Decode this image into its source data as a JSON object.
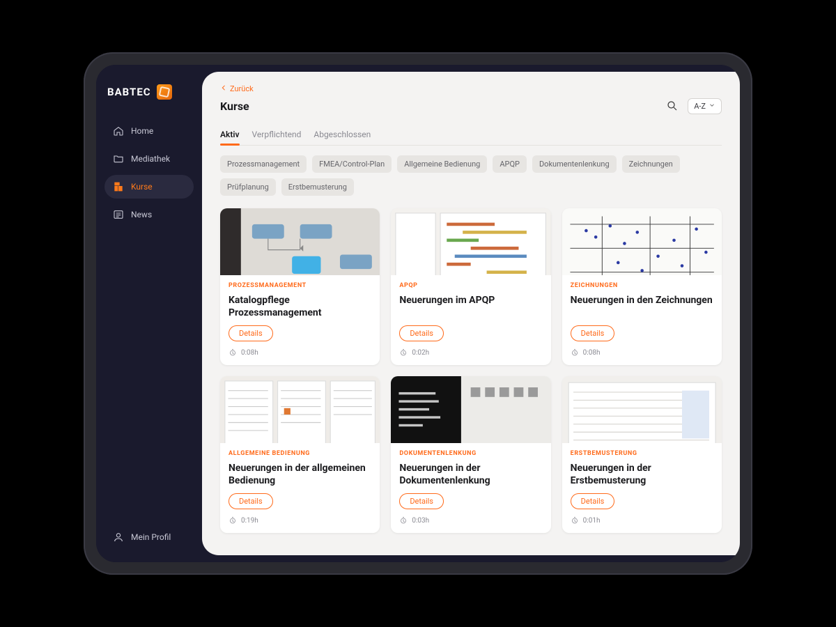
{
  "brand": "BABTEC",
  "sidebar": {
    "items": [
      {
        "label": "Home"
      },
      {
        "label": "Mediathek"
      },
      {
        "label": "Kurse"
      },
      {
        "label": "News"
      }
    ],
    "profile_label": "Mein Profil"
  },
  "header": {
    "back_label": "Zurück",
    "page_title": "Kurse",
    "sort_label": "A-Z"
  },
  "tabs": [
    {
      "label": "Aktiv",
      "active": true
    },
    {
      "label": "Verpflichtend"
    },
    {
      "label": "Abgeschlossen"
    }
  ],
  "chips": [
    "Prozessmanagement",
    "FMEA/Control-Plan",
    "Allgemeine Bedienung",
    "APQP",
    "Dokumentenlenkung",
    "Zeichnungen",
    "Prüfplanung",
    "Erstbemusterung"
  ],
  "card_labels": {
    "details": "Details"
  },
  "cards": [
    {
      "category": "PROZESSMANAGEMENT",
      "title": "Katalogpflege Prozessmanagement",
      "duration": "0:08h"
    },
    {
      "category": "APQP",
      "title": "Neuerungen im APQP",
      "duration": "0:02h"
    },
    {
      "category": "ZEICHNUNGEN",
      "title": "Neuerungen in den Zeichnungen",
      "duration": "0:08h"
    },
    {
      "category": "ALLGEMEINE BEDIENUNG",
      "title": "Neuerungen in der allgemeinen Bedienung",
      "duration": "0:19h"
    },
    {
      "category": "DOKUMENTENLENKUNG",
      "title": "Neuerungen in der Dokumentenlenkung",
      "duration": "0:03h"
    },
    {
      "category": "ERSTBEMUSTERUNG",
      "title": "Neuerungen in der Erstbemusterung",
      "duration": "0:01h"
    }
  ]
}
